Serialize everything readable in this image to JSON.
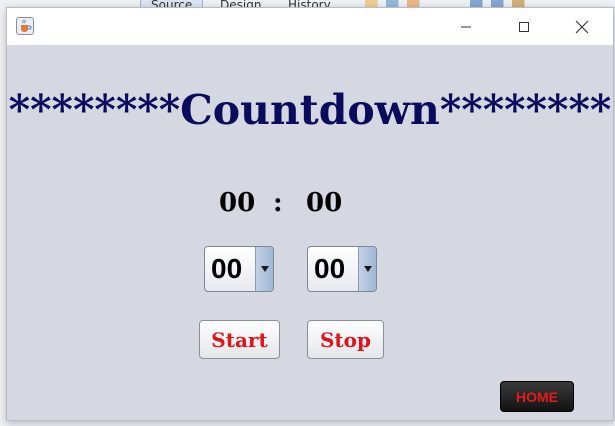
{
  "background_ide": {
    "tabs": [
      "Source",
      "Design",
      "History"
    ]
  },
  "window": {
    "app_icon": "java-cup-icon",
    "controls": {
      "minimize_icon": "minimize-icon",
      "maximize_icon": "maximize-icon",
      "close_icon": "close-icon"
    }
  },
  "main": {
    "title": "********Countdown********",
    "display": {
      "minutes": "00",
      "separator": ":",
      "seconds": "00"
    },
    "minutes_select": {
      "value": "00",
      "arrow_icon": "dropdown-arrow-icon"
    },
    "seconds_select": {
      "value": "00",
      "arrow_icon": "dropdown-arrow-icon"
    },
    "start_label": "Start",
    "stop_label": "Stop",
    "home_label": "HOME"
  },
  "colors": {
    "title": "#0b0b5e",
    "button_text": "#e3121b",
    "window_bg": "#d5d8e1",
    "home_bg": "#1e1e1e"
  }
}
